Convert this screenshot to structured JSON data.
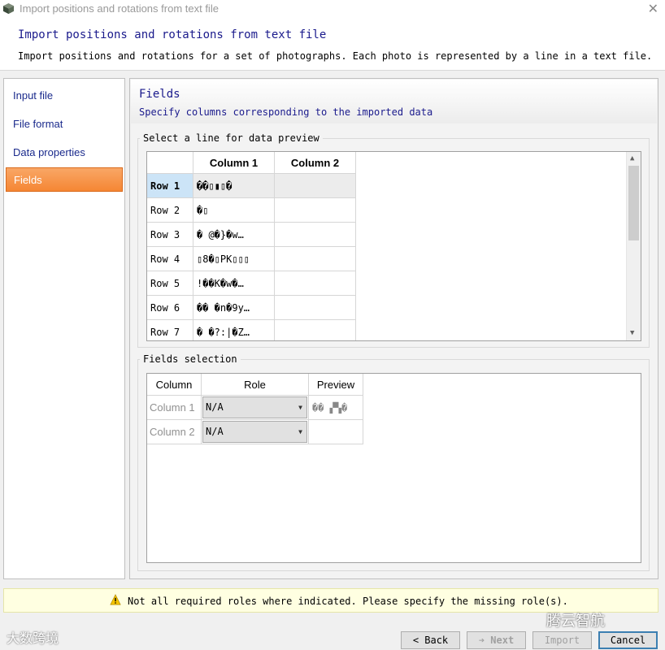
{
  "window": {
    "title": "Import positions and rotations from text file",
    "close_glyph": "✕"
  },
  "header": {
    "title": "Import positions and rotations from text file",
    "subtitle": "Import positions and rotations for a set of photographs. Each photo is represented by a line in a text file."
  },
  "nav": {
    "items": [
      {
        "label": "Input file",
        "active": false
      },
      {
        "label": "File format",
        "active": false
      },
      {
        "label": "Data properties",
        "active": false
      },
      {
        "label": "Fields",
        "active": true
      }
    ]
  },
  "page": {
    "title": "Fields",
    "subtitle": "Specify columns corresponding to the imported data"
  },
  "preview": {
    "legend": "Select a line for data preview",
    "columns": [
      "Column 1",
      "Column 2"
    ],
    "rows": [
      {
        "label": "Row 1",
        "col1": "��▯▮▯�",
        "col2": "",
        "selected": true
      },
      {
        "label": "Row 2",
        "col1": "�▯",
        "col2": "",
        "selected": false
      },
      {
        "label": "Row 3",
        "col1": "�   @�}�w…",
        "col2": "",
        "selected": false
      },
      {
        "label": "Row 4",
        "col1": "▯8�▯PK▯▯▯",
        "col2": "",
        "selected": false
      },
      {
        "label": "Row 5",
        "col1": "!��K�w�…",
        "col2": "",
        "selected": false
      },
      {
        "label": "Row 6",
        "col1": "��  �n�9y…",
        "col2": "",
        "selected": false
      },
      {
        "label": "Row 7",
        "col1": "�  �?:|�Z…",
        "col2": "",
        "selected": false
      }
    ]
  },
  "fields": {
    "legend": "Fields selection",
    "headers": {
      "column": "Column",
      "role": "Role",
      "preview": "Preview"
    },
    "rows": [
      {
        "column": "Column 1",
        "role": "N/A",
        "preview": "��  ▞▚�"
      },
      {
        "column": "Column 2",
        "role": "N/A",
        "preview": ""
      }
    ]
  },
  "warning": {
    "icon": "warning-icon",
    "text": "Not all required roles where indicated. Please specify the missing role(s)."
  },
  "buttons": {
    "back": "< Back",
    "next": "Next",
    "next_icon": "➔",
    "import": "Import",
    "cancel": "Cancel"
  },
  "watermarks": {
    "left": "大数跨境",
    "right": "腾云智航"
  },
  "colors": {
    "accent_orange": "#f58634",
    "title_blue": "#1a1a8c",
    "selection_blue": "#cce4f7",
    "warning_bg": "#ffffe1"
  }
}
